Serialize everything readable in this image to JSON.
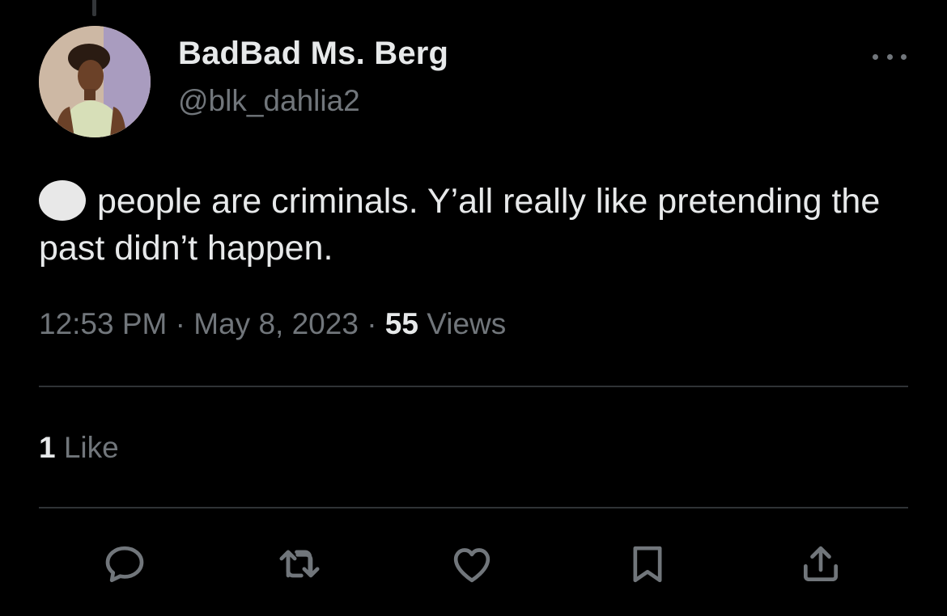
{
  "tweet": {
    "author": {
      "display_name": "BadBad Ms. Berg",
      "handle": "@blk_dahlia2"
    },
    "text": "people are criminals. Y’all really like pretending the past didn’t happen.",
    "leading_emoji": "white-circle",
    "time": "12:53 PM",
    "separator": "·",
    "date": "May 8, 2023",
    "views_count": "55",
    "views_label": "Views",
    "likes_count": "1",
    "likes_label": "Like"
  },
  "actions": {
    "reply": "reply-icon",
    "retweet": "retweet-icon",
    "like": "heart-icon",
    "bookmark": "bookmark-icon",
    "share": "share-icon"
  },
  "colors": {
    "background": "#000000",
    "primary_text": "#e7e9ea",
    "secondary_text": "#71767b",
    "divider": "#2f3336"
  }
}
